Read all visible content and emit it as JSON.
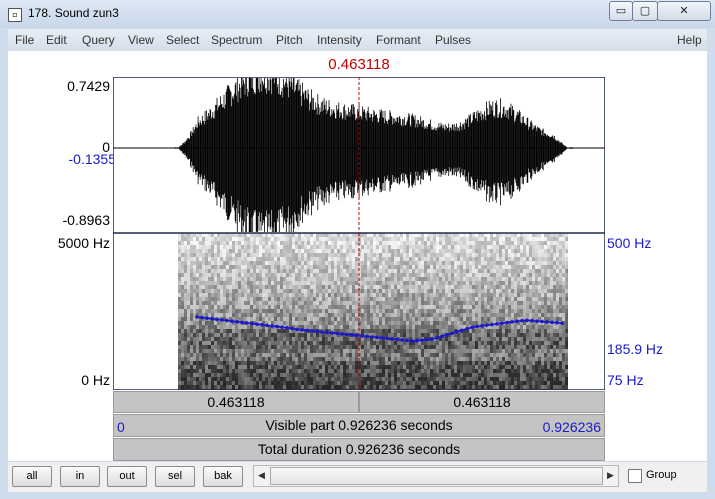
{
  "window": {
    "title": "178. Sound zun3",
    "min_label": "▭",
    "max_label": "▢",
    "close_label": "✕"
  },
  "menu": [
    "File",
    "Edit",
    "Query",
    "View",
    "Select",
    "Spectrum",
    "Pitch",
    "Intensity",
    "Formant",
    "Pulses"
  ],
  "help": "Help",
  "cursor_time": "0.463118",
  "waveform": {
    "max": "0.7429",
    "zero": "0",
    "cursor_value": "-0.1355",
    "min": "-0.8963"
  },
  "spectrogram": {
    "top_freq": "5000 Hz",
    "bottom_freq": "0 Hz"
  },
  "pitch": {
    "top": "500 Hz",
    "cursor": "185.9 Hz",
    "bottom": "75 Hz"
  },
  "time_bar": {
    "left": "0.463118",
    "right": "0.463118"
  },
  "visible_bar": {
    "start": "0",
    "text": "Visible part 0.926236 seconds",
    "end": "0.926236"
  },
  "total_bar": {
    "text": "Total duration 0.926236 seconds"
  },
  "buttons": {
    "all": "all",
    "in": "in",
    "out": "out",
    "sel": "sel",
    "bak": "bak"
  },
  "group": "Group",
  "colors": {
    "cursor": "#c00000",
    "pitch": "#1a1ac8",
    "frame": "#1a2a4a"
  }
}
